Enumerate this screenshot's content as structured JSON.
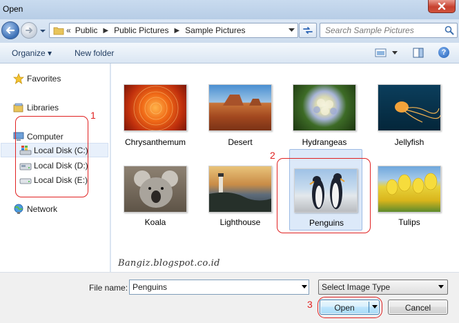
{
  "window": {
    "title": "Open"
  },
  "address": {
    "crumbs": [
      "Public",
      "Public Pictures",
      "Sample Pictures"
    ],
    "overflow": "«"
  },
  "search": {
    "placeholder": "Search Sample Pictures"
  },
  "toolbar": {
    "organize": "Organize ▾",
    "new_folder": "New folder",
    "help": "?"
  },
  "nav": {
    "favorites": "Favorites",
    "libraries": "Libraries",
    "computer": "Computer",
    "disk_c": "Local Disk (C:)",
    "disk_d": "Local Disk (D:)",
    "disk_e": "Local Disk (E:)",
    "network": "Network"
  },
  "files": [
    {
      "name": "Chrysanthemum"
    },
    {
      "name": "Desert"
    },
    {
      "name": "Hydrangeas"
    },
    {
      "name": "Jellyfish"
    },
    {
      "name": "Koala"
    },
    {
      "name": "Lighthouse"
    },
    {
      "name": "Penguins",
      "selected": true
    },
    {
      "name": "Tulips"
    }
  ],
  "watermark": "Bangiz.blogspot.co.id",
  "bottom": {
    "file_name_label": "File name:",
    "file_name_value": "Penguins",
    "file_type": "Select Image Type",
    "open": "Open",
    "cancel": "Cancel"
  },
  "annotations": {
    "one": "1",
    "two": "2",
    "three": "3"
  },
  "colors": {
    "annotation": "#e02020",
    "selection": "#dce9f9",
    "title_bar": "#c9dbef"
  },
  "icons": [
    "close-icon",
    "back-arrow-icon",
    "forward-arrow-icon",
    "folder-icon",
    "refresh-icon",
    "search-icon",
    "view-icon",
    "preview-pane-icon",
    "help-icon",
    "star-icon",
    "library-icon",
    "computer-icon",
    "drive-icon",
    "network-icon"
  ]
}
